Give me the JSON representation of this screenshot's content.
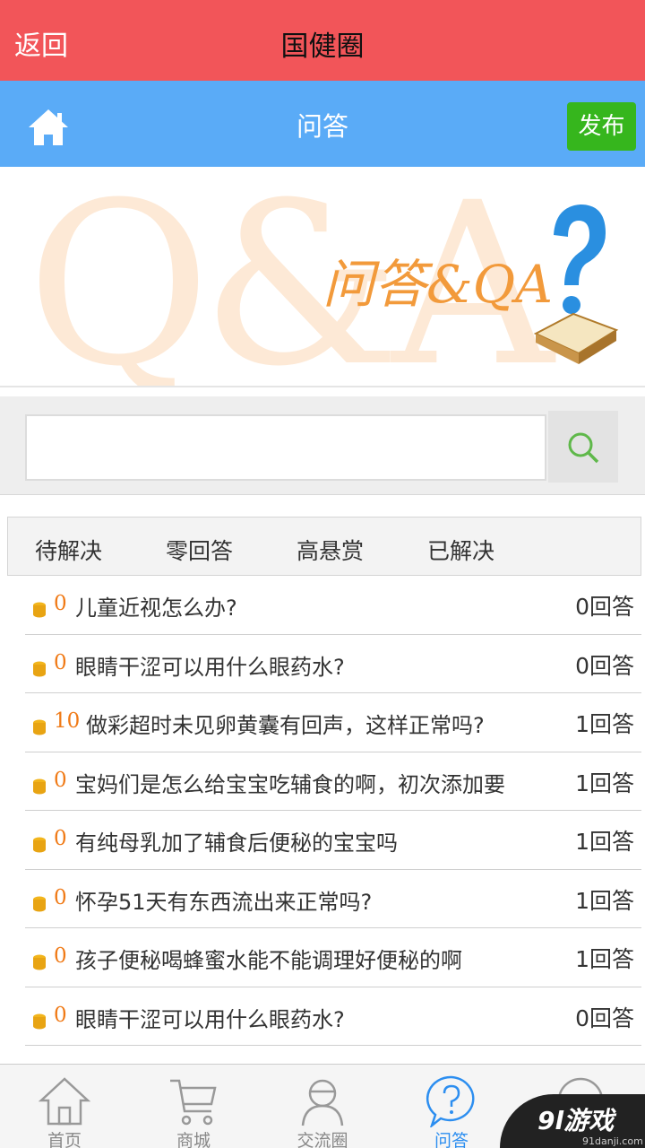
{
  "header": {
    "back_label": "返回",
    "title": "国健圈"
  },
  "subheader": {
    "title": "问答",
    "publish_label": "发布"
  },
  "banner": {
    "big_text": "Q&A",
    "caption": "问答&QA"
  },
  "search": {
    "placeholder": "",
    "value": ""
  },
  "tabs": [
    "待解决",
    "零回答",
    "高悬赏",
    "已解决"
  ],
  "questions": [
    {
      "reward": "0",
      "title": "儿童近视怎么办?",
      "answers": "0回答"
    },
    {
      "reward": "0",
      "title": "眼睛干涩可以用什么眼药水?",
      "answers": "0回答"
    },
    {
      "reward": "10",
      "title": "做彩超时未见卵黄囊有回声，这样正常吗?",
      "answers": "1回答"
    },
    {
      "reward": "0",
      "title": "宝妈们是怎么给宝宝吃辅食的啊，初次添加要",
      "answers": "1回答"
    },
    {
      "reward": "0",
      "title": "有纯母乳加了辅食后便秘的宝宝吗",
      "answers": "1回答"
    },
    {
      "reward": "0",
      "title": "怀孕51天有东西流出来正常吗?",
      "answers": "1回答"
    },
    {
      "reward": "0",
      "title": "孩子便秘喝蜂蜜水能不能调理好便秘的啊",
      "answers": "1回答"
    },
    {
      "reward": "0",
      "title": "眼睛干涩可以用什么眼药水?",
      "answers": "0回答"
    }
  ],
  "bottom_nav": [
    {
      "label": "首页",
      "icon": "home-outline-icon"
    },
    {
      "label": "商城",
      "icon": "cart-icon"
    },
    {
      "label": "交流圈",
      "icon": "community-icon"
    },
    {
      "label": "问答",
      "icon": "question-icon",
      "active": true
    },
    {
      "label": "",
      "icon": "profile-icon"
    }
  ],
  "watermark": {
    "text": "9l游戏",
    "sub": "91danji.com"
  },
  "colors": {
    "header_red": "#f25559",
    "subheader_blue": "#5aabf7",
    "publish_green": "#36b61d",
    "reward_orange": "#f07a16",
    "active_blue": "#2c8ef0"
  }
}
